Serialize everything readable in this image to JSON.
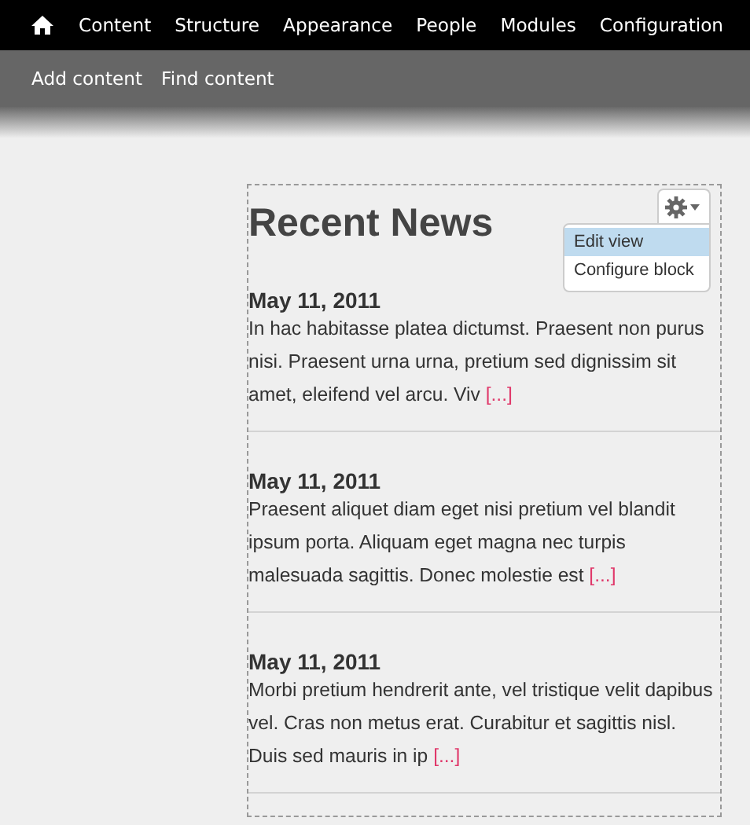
{
  "toolbar": {
    "items": [
      {
        "label": "Content"
      },
      {
        "label": "Structure"
      },
      {
        "label": "Appearance"
      },
      {
        "label": "People"
      },
      {
        "label": "Modules"
      },
      {
        "label": "Configuration"
      }
    ]
  },
  "shortcuts": [
    {
      "label": "Add content"
    },
    {
      "label": "Find content"
    }
  ],
  "block": {
    "title": "Recent News",
    "contextual_menu": [
      {
        "label": "Edit view",
        "selected": true
      },
      {
        "label": "Configure block",
        "selected": false
      }
    ],
    "items": [
      {
        "date": "May 11, 2011",
        "text": "In hac habitasse platea dictumst. Praesent non purus nisi. Praesent urna urna, pretium sed dignissim sit amet, eleifend vel arcu. Viv",
        "more": "[...]"
      },
      {
        "date": "May 11, 2011",
        "text": "Praesent aliquet diam eget nisi pretium vel blandit ipsum porta. Aliquam eget magna nec turpis malesuada sagittis. Donec molestie est",
        "more": "[...]"
      },
      {
        "date": "May 11, 2011",
        "text": "Morbi pretium hendrerit ante, vel tristique velit dapibus vel. Cras non metus erat. Curabitur et sagittis nisl. Duis sed mauris in ip",
        "more": "[...]"
      }
    ]
  }
}
